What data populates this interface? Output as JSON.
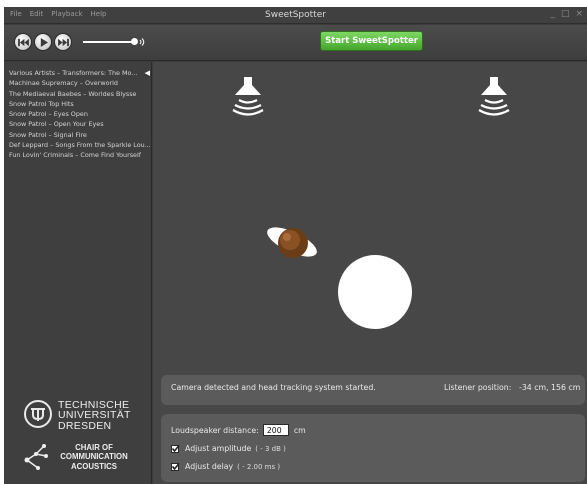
{
  "window": {
    "title": "SweetSpotter",
    "menu": [
      "File",
      "Edit",
      "Playback",
      "Help"
    ],
    "controls": [
      "_",
      "□",
      "×"
    ]
  },
  "toolbar": {
    "buttons": [
      {
        "icon": "previous-icon"
      },
      {
        "icon": "play-icon"
      },
      {
        "icon": "next-icon"
      }
    ],
    "volume_level": 0.95,
    "volume_icon": "speaker-volume-icon",
    "start_label": "Start SweetSpotter",
    "accent_color": "#56b83a"
  },
  "playlist": {
    "tracks": [
      "Various Artists – Transformers: The Mo...",
      "Machinae Supremacy – Overworld",
      "The Mediaeval Baebes – Worldes Blysse",
      "Snow Patrol Top Hits",
      "Snow Patrol – Eyes Open",
      "Snow Patrol – Open Your Eyes",
      "Snow Patrol – Signal Fire",
      "Def Leppard – Songs From the Sparkle Lou...",
      "Fun Lovin' Criminals – Come Find Yourself"
    ],
    "current_index": 0,
    "current_marker": "◀"
  },
  "logos": {
    "tud": {
      "lines": [
        "TECHNISCHE",
        "UNIVERSITÄT",
        "DRESDEN"
      ]
    },
    "cca": {
      "lines": [
        "CHAIR OF",
        "COMMUNICATION",
        "ACOUSTICS"
      ]
    }
  },
  "stage": {
    "status_message": "Camera detected and head tracking system started.",
    "listener_label": "Listener position:",
    "listener_value": "-34  cm, 156 cm"
  },
  "settings": {
    "distance_label": "Loudspeaker distance:",
    "distance_value": "200",
    "distance_unit": "cm",
    "amplitude_label": "Adjust amplitude",
    "amplitude_value": "( - 3 dB )",
    "amplitude_checked": true,
    "delay_label": "Adjust delay",
    "delay_value": "( - 2.00 ms )",
    "delay_checked": true
  }
}
